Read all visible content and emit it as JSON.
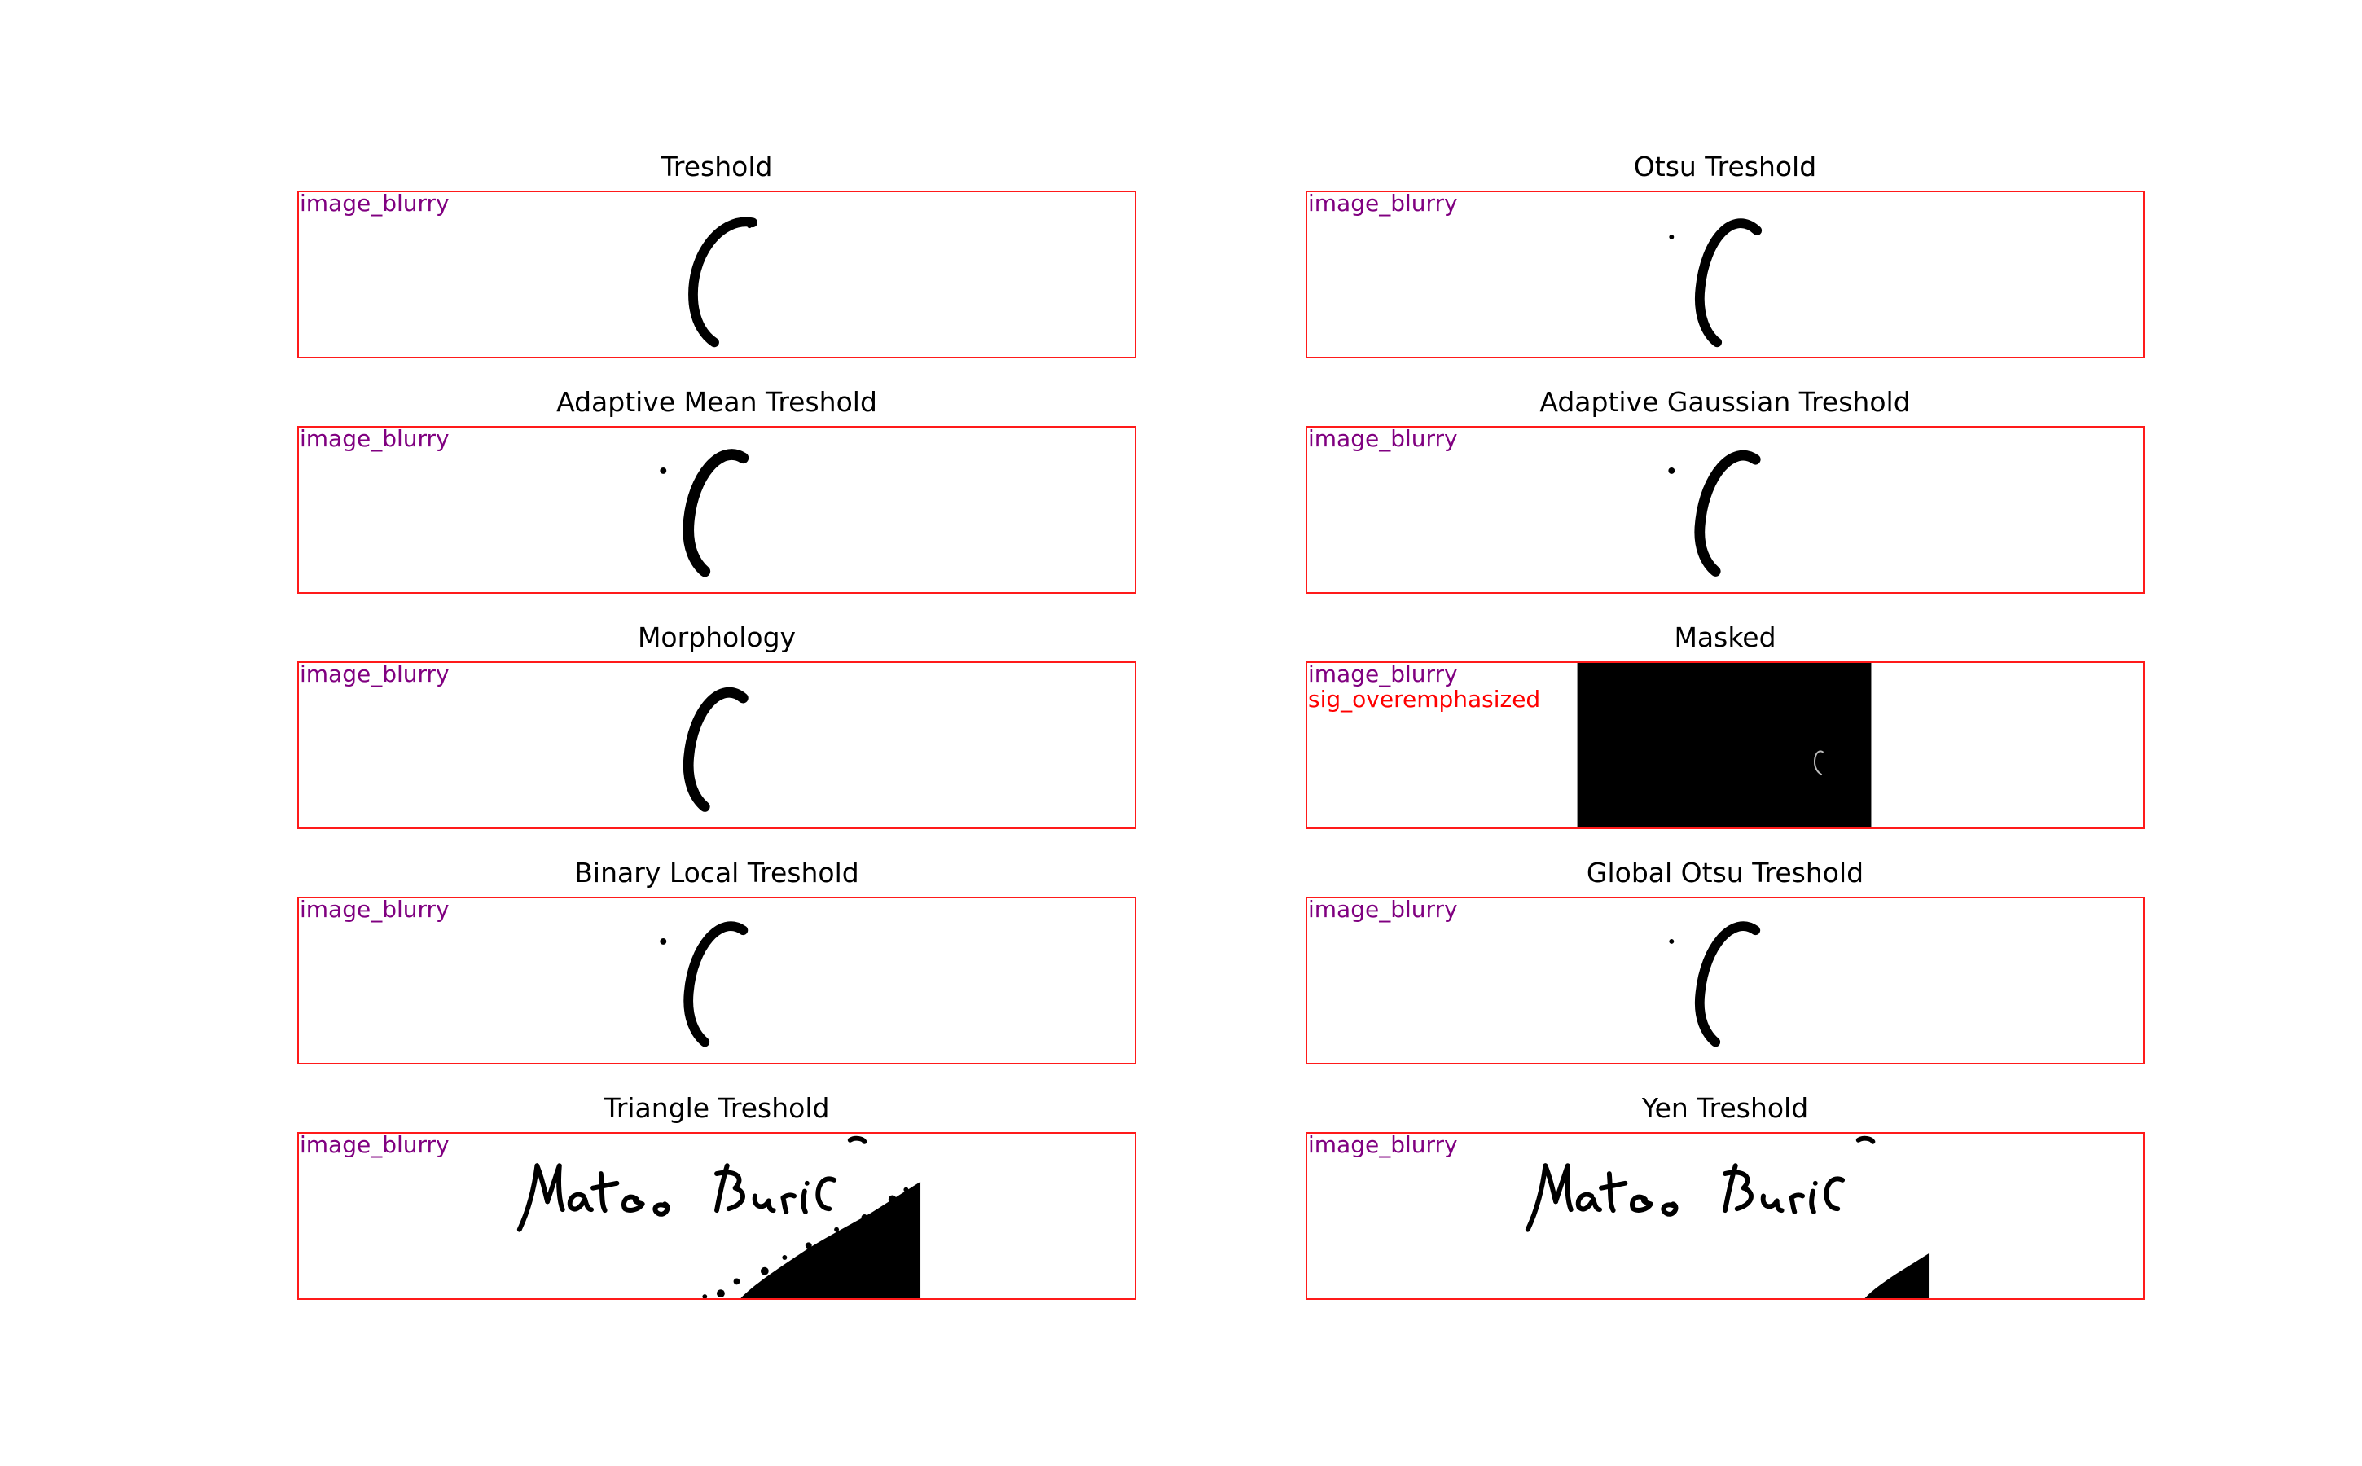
{
  "colors": {
    "frame": "#ff1a1a",
    "tag_blurry": "#800080",
    "tag_sig": "#ff0000",
    "ink": "#000000"
  },
  "panels": [
    {
      "title": "Treshold",
      "tags": [
        "image_blurry"
      ]
    },
    {
      "title": "Otsu Treshold",
      "tags": [
        "image_blurry"
      ]
    },
    {
      "title": "Adaptive Mean Treshold",
      "tags": [
        "image_blurry"
      ]
    },
    {
      "title": "Adaptive Gaussian Treshold",
      "tags": [
        "image_blurry"
      ]
    },
    {
      "title": "Morphology",
      "tags": [
        "image_blurry"
      ]
    },
    {
      "title": "Masked",
      "tags": [
        "image_blurry",
        "sig_overemphasized"
      ]
    },
    {
      "title": "Binary Local Treshold",
      "tags": [
        "image_blurry"
      ]
    },
    {
      "title": "Global Otsu Treshold",
      "tags": [
        "image_blurry"
      ]
    },
    {
      "title": "Triangle Treshold",
      "tags": [
        "image_blurry"
      ]
    },
    {
      "title": "Yen Treshold",
      "tags": [
        "image_blurry"
      ]
    }
  ]
}
